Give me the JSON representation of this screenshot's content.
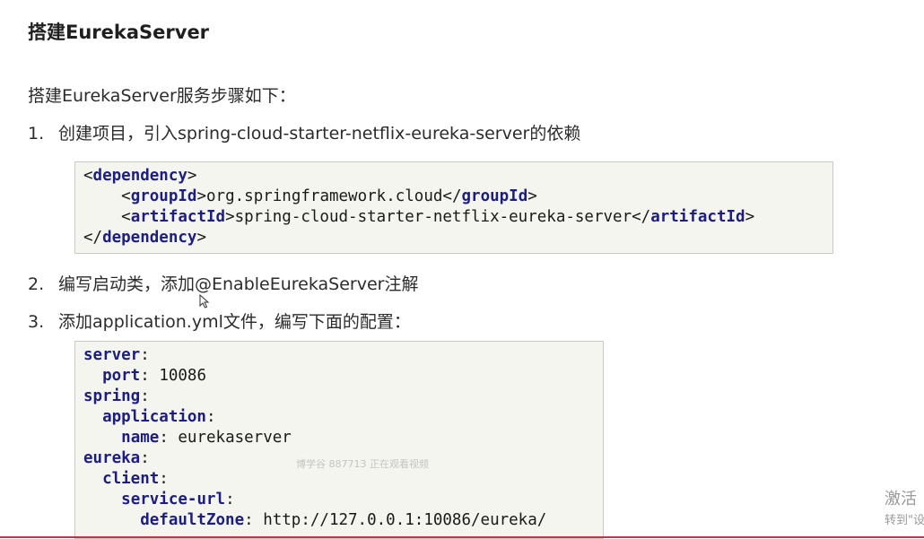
{
  "title": "搭建EurekaServer",
  "intro": "搭建EurekaServer服务步骤如下：",
  "steps": [
    {
      "num": "1.",
      "text": "创建项目，引入spring-cloud-starter-netflix-eureka-server的依赖"
    },
    {
      "num": "2.",
      "text": "编写启动类，添加@EnableEurekaServer注解"
    },
    {
      "num": "3.",
      "text": "添加application.yml文件，编写下面的配置："
    }
  ],
  "code1": {
    "dependency_tag": "dependency",
    "groupId_tag": "groupId",
    "groupId_value": "org.springframework.cloud",
    "artifactId_tag": "artifactId",
    "artifactId_value": "spring-cloud-starter-netflix-eureka-server"
  },
  "code2": {
    "server_key": "server",
    "port_key": "port",
    "port_value": "10086",
    "spring_key": "spring",
    "application_key": "application",
    "name_key": "name",
    "name_value": "eurekaserver",
    "eureka_key": "eureka",
    "client_key": "client",
    "service_url_key": "service-url",
    "default_zone_key": "defaultZone",
    "default_zone_value": "http://127.0.0.1:10086/eureka/"
  },
  "watermark": "博学谷 887713 正在观看视频",
  "activate": {
    "line1": "激活",
    "line2": "转到\"设"
  },
  "colors": {
    "code_keyword": "#1d1d82",
    "code_background": "#f3f5ee",
    "bottom_rule": "#b83a3a"
  },
  "icons": {
    "cursor": "mouse-pointer-icon"
  }
}
